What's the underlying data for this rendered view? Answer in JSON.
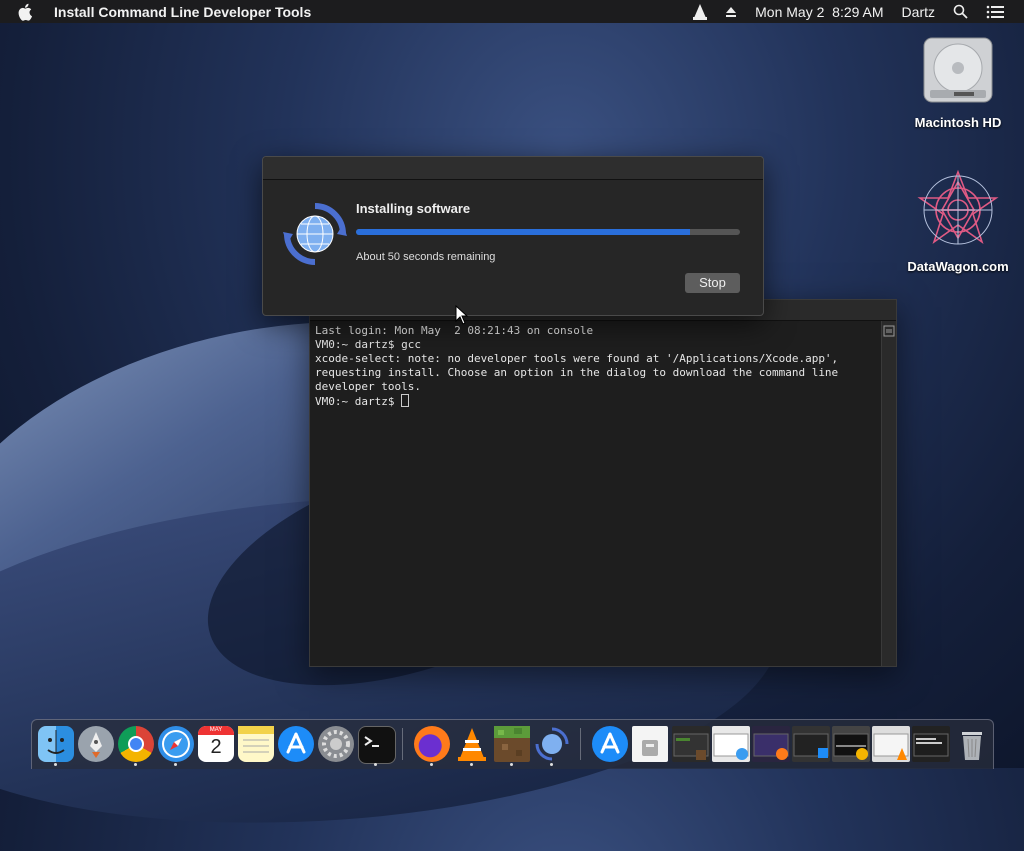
{
  "menubar": {
    "app_title": "Install Command Line Developer Tools",
    "clock": "Mon May 2  8:29 AM",
    "user": "Dartz",
    "icons": [
      "apple-icon",
      "vlc-icon",
      "eject-icon",
      "search-icon",
      "list-icon"
    ]
  },
  "desktop": {
    "items": [
      {
        "label": "Macintosh HD",
        "icon": "hard-drive-icon"
      },
      {
        "label": "DataWagon.com",
        "icon": "datawagon-icon"
      }
    ]
  },
  "installer": {
    "heading": "Installing software",
    "remaining": "About 50 seconds remaining",
    "progress": 0.87,
    "stop_label": "Stop",
    "accent": "#2a6fdb"
  },
  "terminal": {
    "lines": [
      "Last login: Mon May  2 08:21:43 on console",
      "VM0:~ dartz$ gcc",
      "xcode-select: note: no developer tools were found at '/Applications/Xcode.app',",
      "requesting install. Choose an option in the dialog to download the command line",
      "developer tools.",
      "VM0:~ dartz$ "
    ]
  },
  "dock": {
    "calendar_day": "2",
    "calendar_month": "MAY",
    "apps": [
      "finder",
      "launchpad",
      "chrome",
      "safari",
      "calendar",
      "notes",
      "app-store",
      "system-preferences",
      "terminal",
      "firefox",
      "vlc",
      "minecraft",
      "installer",
      "app-store-folder",
      "documents",
      "window-thumbnails",
      "trash"
    ]
  }
}
